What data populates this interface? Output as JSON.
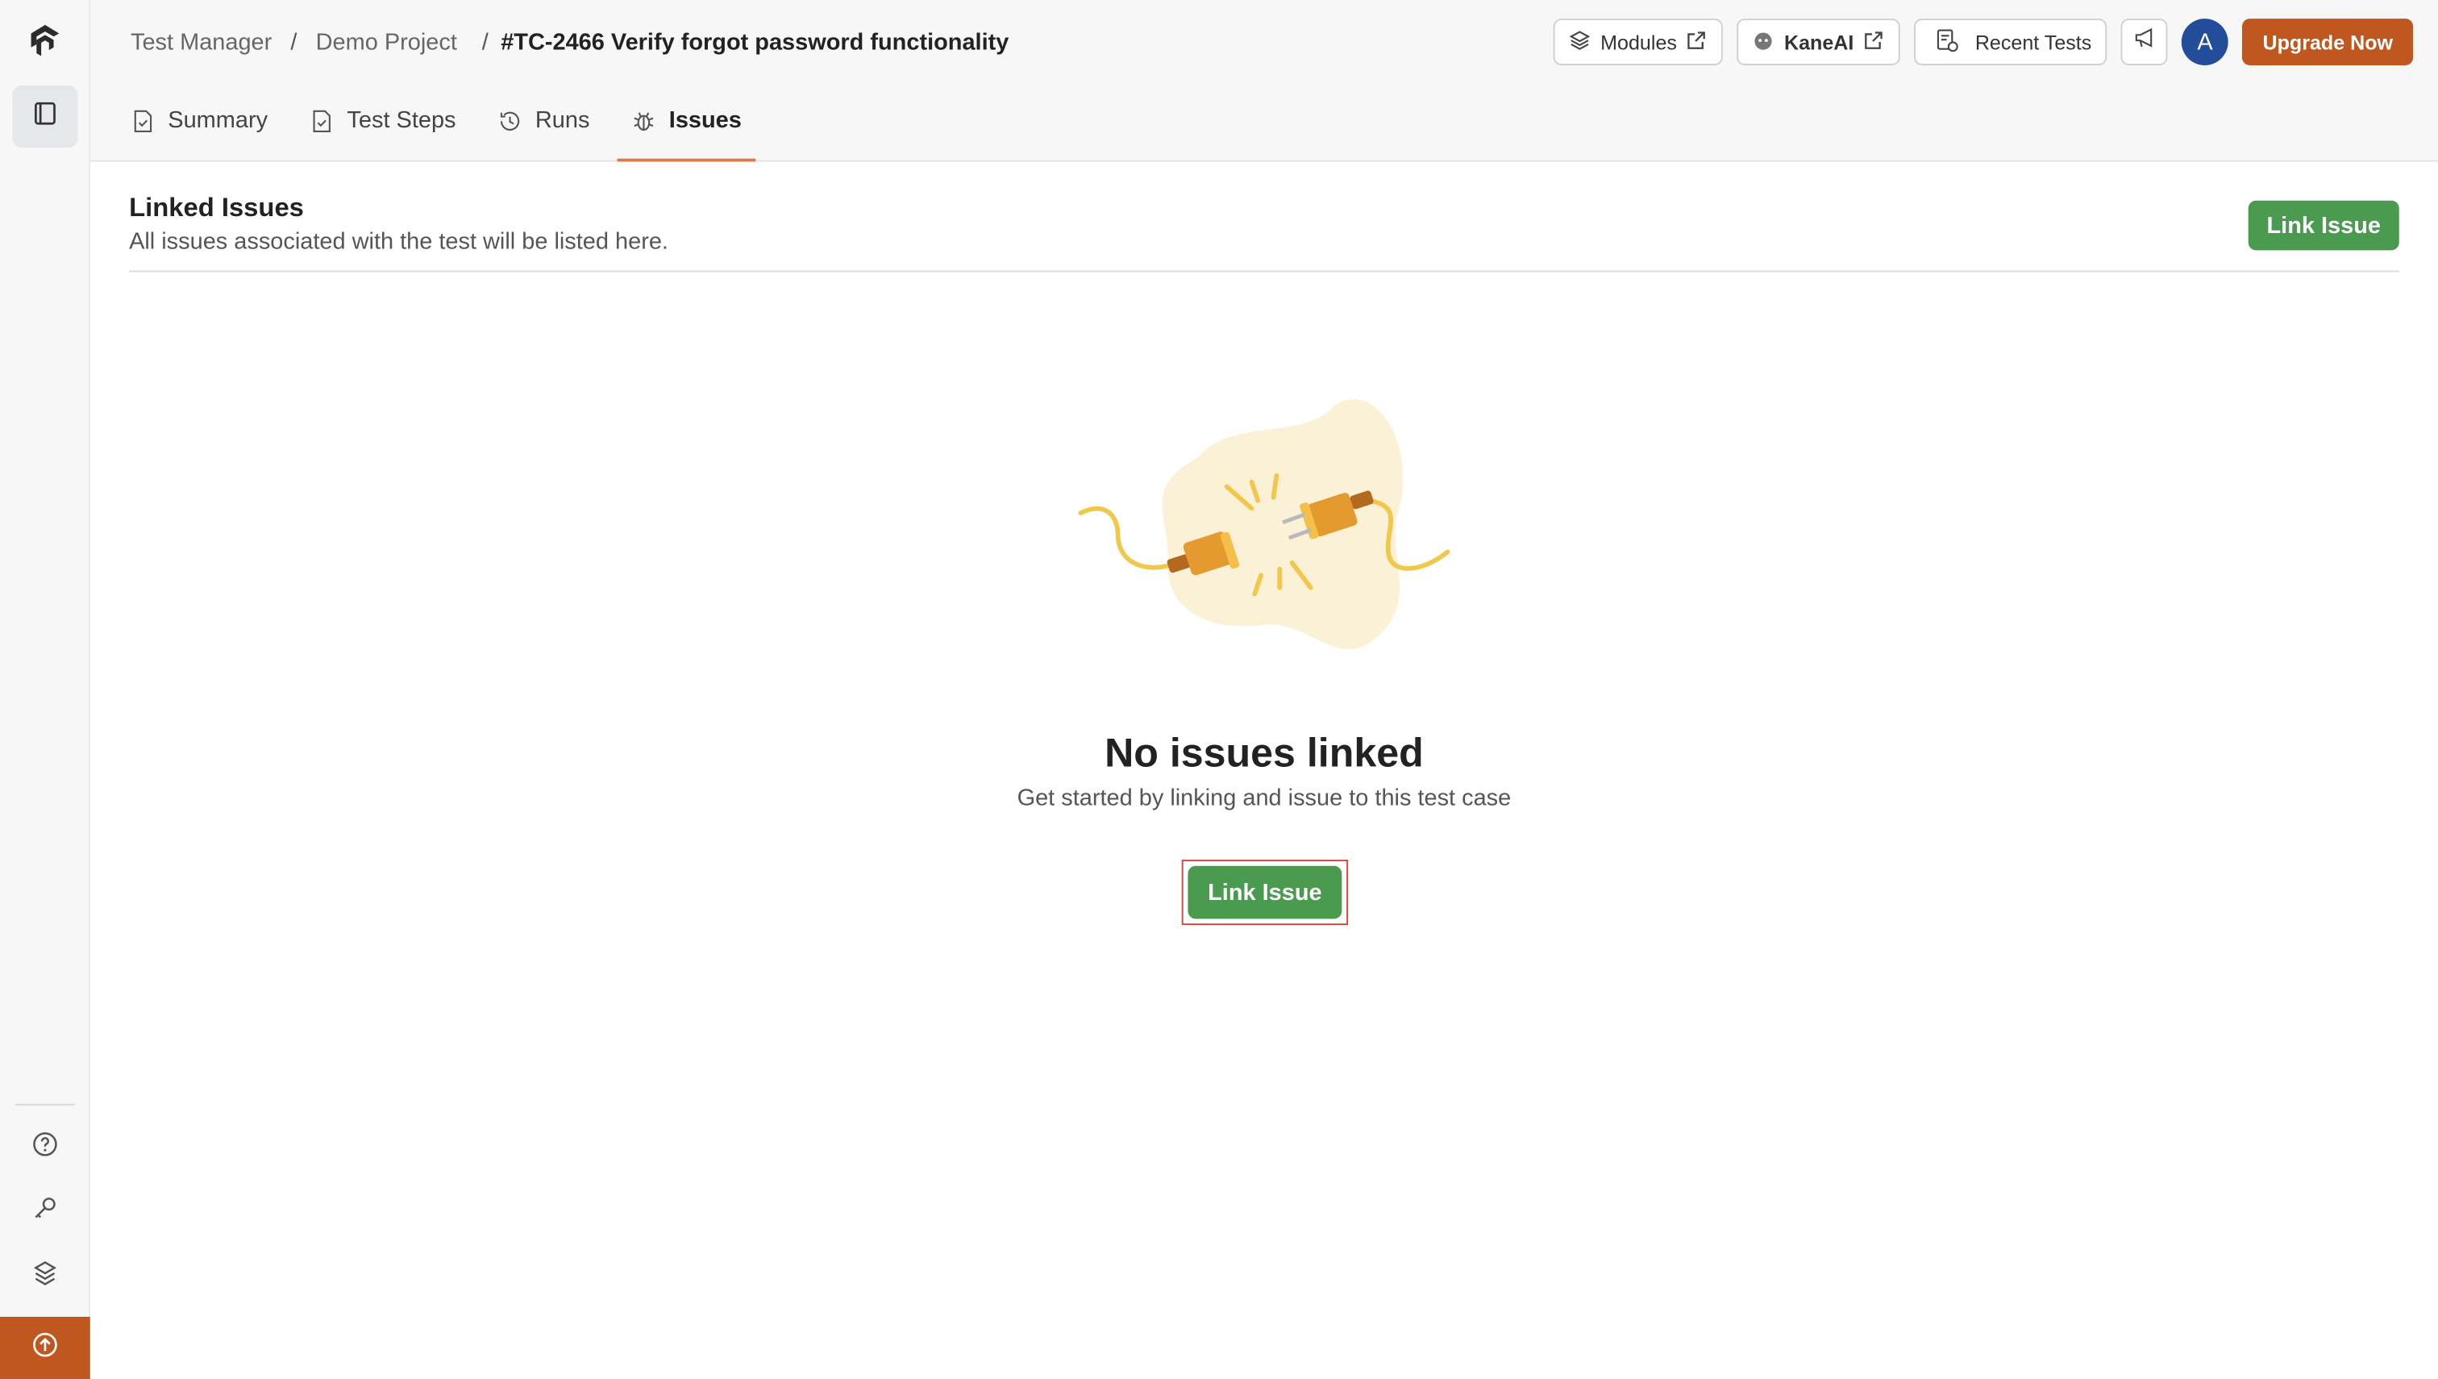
{
  "breadcrumb": {
    "items": [
      "Test Manager",
      "Demo Project"
    ],
    "separator": "/",
    "current": "#TC-2466 Verify forgot password functionality"
  },
  "top_actions": {
    "modules_label": "Modules",
    "kaneai_label": "KaneAI",
    "recent_tests_label": "Recent Tests",
    "avatar_initial": "A",
    "upgrade_label": "Upgrade Now"
  },
  "tabs": [
    {
      "label": "Summary",
      "icon": "summary-icon",
      "active": false
    },
    {
      "label": "Test Steps",
      "icon": "test-steps-icon",
      "active": false
    },
    {
      "label": "Runs",
      "icon": "history-icon",
      "active": false
    },
    {
      "label": "Issues",
      "icon": "bug-icon",
      "active": true
    }
  ],
  "section": {
    "title": "Linked Issues",
    "subtitle": "All issues associated with the test will be listed here.",
    "button_label": "Link Issue"
  },
  "empty_state": {
    "title": "No issues linked",
    "subtitle": "Get started by linking and issue to this test case",
    "button_label": "Link Issue",
    "illustration": "unplugged-cable-illustration"
  },
  "colors": {
    "accent": "#c0571f",
    "green": "#4a9a4f",
    "tab_underline": "#e0774a",
    "highlight_border": "#e0433a",
    "avatar": "#234c9a"
  }
}
